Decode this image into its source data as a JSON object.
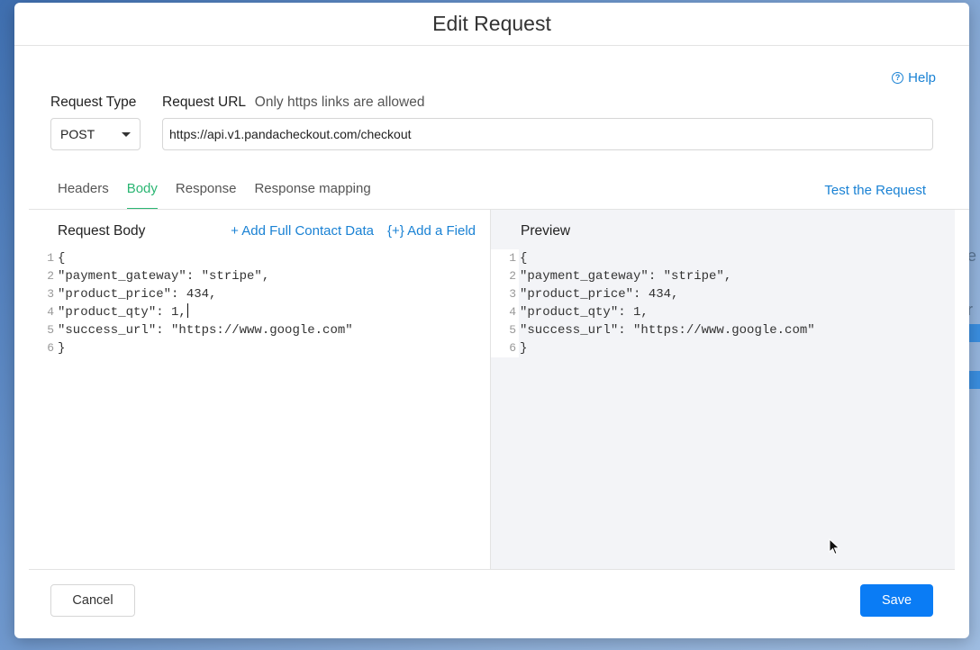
{
  "modal": {
    "title": "Edit Request"
  },
  "help": {
    "label": "Help",
    "icon": "question-circle-icon"
  },
  "request_type": {
    "label": "Request Type",
    "value": "POST"
  },
  "request_url": {
    "label": "Request URL",
    "hint": "Only https links are allowed",
    "value": "https://api.v1.pandacheckout.com/checkout"
  },
  "tabs": [
    {
      "label": "Headers",
      "active": false
    },
    {
      "label": "Body",
      "active": true
    },
    {
      "label": "Response",
      "active": false
    },
    {
      "label": "Response mapping",
      "active": false
    }
  ],
  "test_request": {
    "label": "Test the Request"
  },
  "request_body": {
    "title": "Request Body",
    "add_contact": "+ Add Full Contact Data",
    "add_field": "{+} Add a Field",
    "lines": [
      {
        "num": "1",
        "text": "{"
      },
      {
        "num": "2",
        "text": "\"payment_gateway\": \"stripe\","
      },
      {
        "num": "3",
        "text": "\"product_price\": 434,"
      },
      {
        "num": "4",
        "text": "\"product_qty\": 1,"
      },
      {
        "num": "5",
        "text": "\"success_url\": \"https://www.google.com\""
      },
      {
        "num": "6",
        "text": "}"
      }
    ]
  },
  "preview": {
    "title": "Preview",
    "lines": [
      {
        "num": "1",
        "text": "{"
      },
      {
        "num": "2",
        "text": "\"payment_gateway\": \"stripe\","
      },
      {
        "num": "3",
        "text": "\"product_price\": 434,"
      },
      {
        "num": "4",
        "text": "\"product_qty\": 1,"
      },
      {
        "num": "5",
        "text": "\"success_url\": \"https://www.google.com\""
      },
      {
        "num": "6",
        "text": "}"
      }
    ]
  },
  "footer": {
    "cancel": "Cancel",
    "save": "Save"
  },
  "colors": {
    "accent_blue": "#0a7cf5",
    "link_blue": "#1a82d4",
    "active_tab_green": "#2bb673"
  }
}
